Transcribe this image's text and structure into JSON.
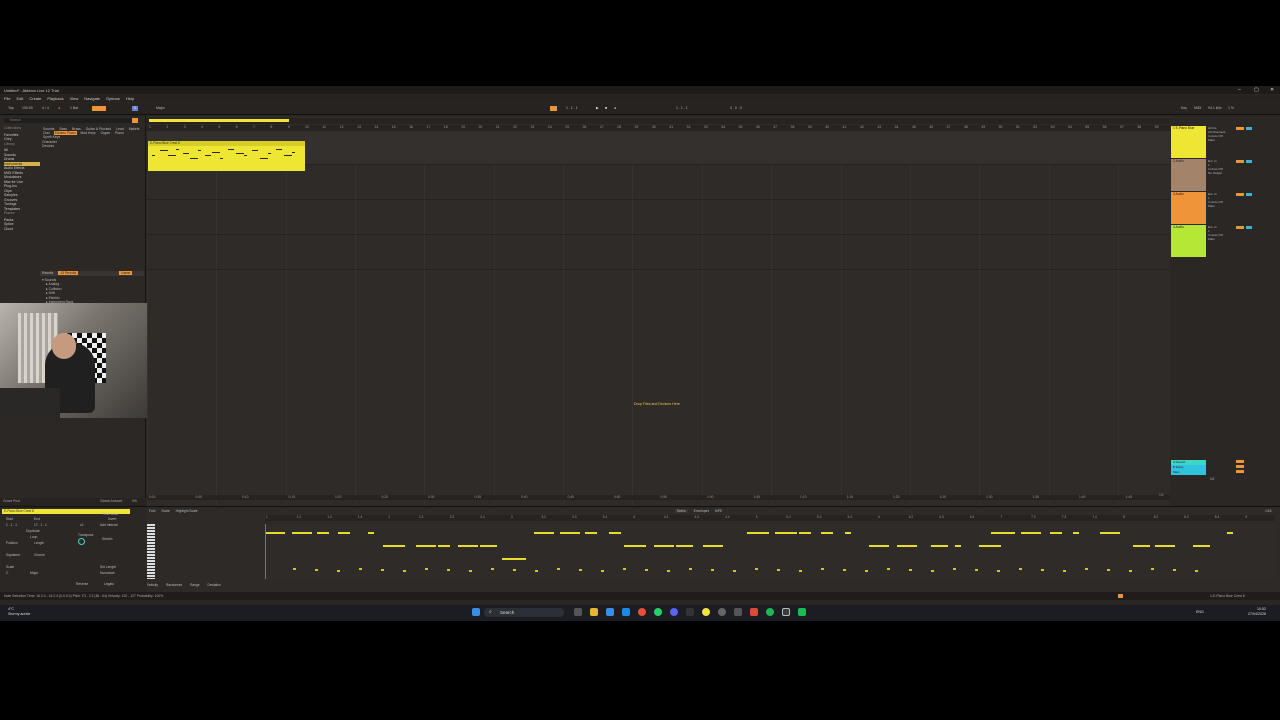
{
  "window": {
    "title": "Untitled* - Ableton Live 12 Trial",
    "min": "–",
    "max": "▢",
    "close": "✕"
  },
  "menu": [
    "File",
    "Edit",
    "Create",
    "Playback",
    "View",
    "Navigate",
    "Options",
    "Help"
  ],
  "control_bar": {
    "tap": "Tap",
    "tempo": "100.00",
    "sig": "4 / 4",
    "metro": "●",
    "quant": "1 Bar",
    "key": "C",
    "scale": "Major",
    "position": "1 . 1 . 1",
    "loop_start": "1 . 1 . 1",
    "loop_len": "4 . 0 . 0",
    "key_label": "Key",
    "midi": "MIDI",
    "cpu": "94.1 kHz",
    "cpu_pct": "1 %"
  },
  "browser": {
    "search_placeholder": "Search",
    "collections": [
      "Collections",
      "Favorites",
      "Grey"
    ],
    "library": [
      "Library",
      "All",
      "Sounds",
      "Drums",
      "Instruments",
      "Audio Effects",
      "MIDI Effects",
      "Modulators",
      "Max for Live",
      "Plug-Ins",
      "Clips",
      "Samples",
      "Grooves",
      "Tunings",
      "Templates"
    ],
    "places": [
      "Places",
      "Packs",
      "Splice",
      "Cloud"
    ],
    "tags_top": [
      "Sounds",
      "Bass",
      "Brass",
      "Guitar & Plucked",
      "Lead",
      "Mallets",
      "Pad",
      "Piano & Keys",
      "Strings",
      "Voices",
      "Woodwind",
      "Ambience & FX"
    ],
    "tags_row2": [
      "Clav",
      "Electric Piano",
      "Mod Keys",
      "Organ",
      "Piano"
    ],
    "tags_row3": [
      "Synth Keys"
    ],
    "character": "Character",
    "devices": "Devices",
    "results_label": "Results",
    "results_count": "13 Results",
    "results_filter": "Name",
    "tree": [
      "Sounds",
      "Analog",
      "Collision",
      "Drift",
      "Electric",
      "Instrument Rack",
      "Operator",
      "Sampler",
      "Simpler",
      "E-Piano Blue Crest.adv",
      "E-Piano Crisp.adv",
      "E-Piano C Maj7 Chord.adv",
      "E-Piano C Min7 Chord.adv",
      "E-Piano Nobility.adv",
      "Tension"
    ],
    "tags_footer": [
      "Tags",
      "Chord",
      "Electric Piano"
    ]
  },
  "arrangement": {
    "ruler": [
      "1",
      "2",
      "3",
      "4",
      "5",
      "6",
      "7",
      "8",
      "9",
      "10",
      "11",
      "12",
      "13",
      "14",
      "15",
      "16",
      "17",
      "18",
      "19",
      "20",
      "21",
      "22",
      "23",
      "24",
      "25",
      "26",
      "27",
      "28",
      "29",
      "30",
      "31",
      "32",
      "33",
      "34",
      "35",
      "36",
      "37",
      "38",
      "39",
      "40",
      "41",
      "42",
      "43",
      "44",
      "45",
      "46",
      "47",
      "48",
      "49",
      "50",
      "51",
      "52",
      "53",
      "54",
      "55",
      "56",
      "57",
      "58",
      "59"
    ],
    "clip_name": "E-Piano Blue Crest 8",
    "drop_text": "Drop Files and Devices Here",
    "time_ruler": [
      "0:00",
      "0:05",
      "0:10",
      "0:15",
      "0:20",
      "0:25",
      "0:30",
      "0:35",
      "0:40",
      "0:45",
      "0:50",
      "0:55",
      "1:00",
      "1:05",
      "1:10",
      "1:15",
      "1:20",
      "1:25",
      "1:30",
      "1:35",
      "1:40",
      "1:45"
    ],
    "time_fraction": "1/2"
  },
  "mixer": {
    "tracks": [
      {
        "name": "1 E-Piano Blue",
        "color": "#efe533",
        "input": "All Ins",
        "channel": "All Channels",
        "mon": "In Auto Off",
        "out": "Main"
      },
      {
        "name": "2 Audio",
        "color": "#a3846a",
        "input": "Ext. In",
        "channel": "1",
        "mon": "In Auto Off",
        "out": "No Output"
      },
      {
        "name": "3 Audio",
        "color": "#f0943a",
        "input": "Ext. In",
        "channel": "1",
        "mon": "In Auto Off",
        "out": "Main"
      },
      {
        "name": "4 Audio",
        "color": "#b5e834",
        "input": "Ext. In",
        "channel": "1",
        "mon": "In Auto Off",
        "out": "Main"
      }
    ],
    "returns": [
      {
        "name": "A Reverb",
        "color": "#3fd6c8"
      },
      {
        "name": "B Delay",
        "color": "#2ec4e0"
      },
      {
        "name": "Main",
        "color": "#2ec4e0"
      }
    ],
    "main_label": "1/2"
  },
  "info_view": {
    "left": "Grove Pool",
    "right_label": "Global Amount",
    "right_value": "0%"
  },
  "clip_panel": {
    "title": "E-Piano Blue Crest 8",
    "start_label": "Start",
    "end_label": "End",
    "start": "1 . 1 . 1",
    "end": "17 . 1 . 1",
    "duplicate": "Duplicate",
    "double": "x2",
    "loop": "Loop",
    "position": "Position",
    "length": "Length",
    "signature": "Signature",
    "groove": "Groove",
    "scale": "Scale",
    "scale_value": "Major",
    "key": "C",
    "fit_scale": "Fit to Scale",
    "invert": "Invert",
    "add_interval": "Add Interval",
    "stretch": "Stretch",
    "transpose_label": "Transpose",
    "set_length": "Set Length",
    "humanize": "Humanize",
    "velocity": "Velocity",
    "legato": "Legato",
    "reverse": "Reverse"
  },
  "note_editor": {
    "tabs": [
      "Fold",
      "Scale",
      "Highlight Scale"
    ],
    "views": [
      "Notes",
      "Envelopes",
      "MPE"
    ],
    "ruler": [
      "1",
      "1.2",
      "1.3",
      "1.4",
      "2",
      "2.2",
      "2.3",
      "2.4",
      "3",
      "3.2",
      "3.3",
      "3.4",
      "4",
      "4.2",
      "4.3",
      "4.4",
      "5",
      "5.2",
      "5.3",
      "5.4",
      "6",
      "6.2",
      "6.3",
      "6.4",
      "7",
      "7.2",
      "7.3",
      "7.4",
      "8",
      "8.2",
      "8.3",
      "8.4",
      "9"
    ],
    "lanes": [
      "Velocity",
      "Randomize",
      "Range",
      "Deviation"
    ],
    "zoom": "1/16"
  },
  "status": {
    "left": "Note Selection   Time: 16.2.4 - 16.2.4 (0.0.0.0)   Pitch: F3 - C3 (38 - 64)   Velocity: 120 - 127   Probability: 100%",
    "track": "1-E-Piano Blue Crest 8"
  },
  "taskbar": {
    "weather_temp": "4°C",
    "weather_desc": "Stormy aurlde",
    "search": "Search",
    "lang": "ENG",
    "time": "10:52",
    "date": "27/04/2026"
  },
  "colors": {
    "yellow": "#efe533",
    "orange": "#f0943a",
    "cyan": "#3fd6c8"
  }
}
